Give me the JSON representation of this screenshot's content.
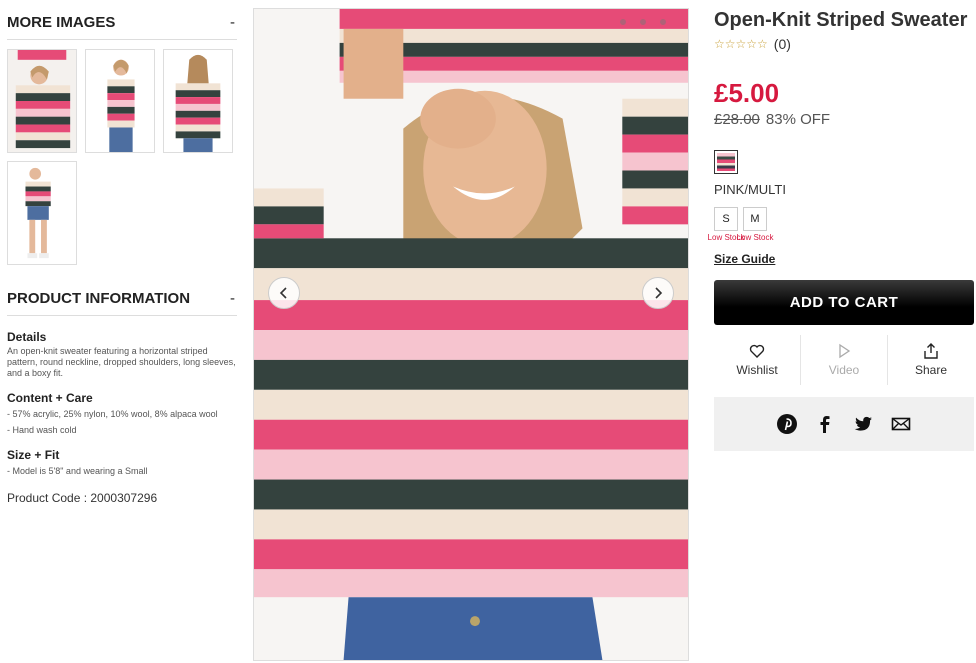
{
  "more_images": {
    "heading": "MORE IMAGES",
    "toggle": "-",
    "thumbnails": [
      "thumb-front-arm-raised",
      "thumb-side",
      "thumb-back",
      "thumb-full-body"
    ]
  },
  "product_information": {
    "heading": "PRODUCT INFORMATION",
    "toggle": "-",
    "details_title": "Details",
    "details_text": "An open-knit sweater featuring a horizontal striped pattern, round neckline, dropped shoulders, long sleeves, and a boxy fit.",
    "content_title": "Content + Care",
    "content_items": [
      "- 57% acrylic, 25% nylon, 10% wool, 8% alpaca wool",
      "- Hand wash cold"
    ],
    "size_title": "Size + Fit",
    "size_items": [
      "- Model is 5'8\" and wearing a Small"
    ],
    "product_code": "Product Code : 2000307296"
  },
  "product": {
    "title": "Open-Knit Striped Sweater",
    "stars": "☆☆☆☆☆",
    "review_count": "(0)",
    "price": "£5.00",
    "original_price": "£28.00",
    "discount": "83% OFF",
    "color_name": "PINK/MULTI",
    "sizes": [
      {
        "label": "S",
        "stock": "Low Stock"
      },
      {
        "label": "M",
        "stock": "Low Stock"
      }
    ],
    "size_guide": "Size Guide",
    "add_to_cart": "ADD TO CART"
  },
  "actions": [
    {
      "label": "Wishlist",
      "icon": "heart-icon"
    },
    {
      "label": "Video",
      "icon": "play-icon"
    },
    {
      "label": "Share",
      "icon": "share-icon"
    }
  ],
  "share_icons": [
    "pinterest-icon",
    "facebook-icon",
    "twitter-icon",
    "email-icon"
  ],
  "colors": {
    "price_red": "#d6193f",
    "stripe_pink": "#e64b77",
    "stripe_dark": "#34423e",
    "stripe_cream": "#f1e3d4"
  }
}
